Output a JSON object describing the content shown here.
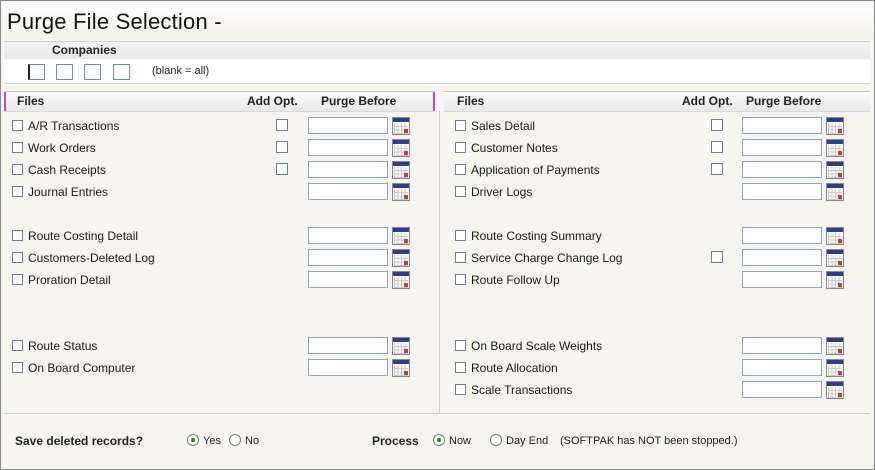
{
  "window": {
    "title": "Purge File Selection -"
  },
  "companies": {
    "heading": "Companies",
    "note": "(blank = all)"
  },
  "columns": {
    "files": "Files",
    "add_opt": "Add Opt.",
    "purge_before": "Purge Before"
  },
  "left_files": [
    {
      "label": "A/R Transactions",
      "add_opt": true
    },
    {
      "label": "Work Orders",
      "add_opt": true
    },
    {
      "label": "Cash Receipts",
      "add_opt": true
    },
    {
      "label": "Journal Entries",
      "add_opt": false
    },
    {
      "label": "Route Costing Detail",
      "add_opt": false
    },
    {
      "label": "Customers-Deleted Log",
      "add_opt": false
    },
    {
      "label": "Proration Detail",
      "add_opt": false
    },
    {
      "label": "Route Status",
      "add_opt": false
    },
    {
      "label": "On Board Computer",
      "add_opt": false
    }
  ],
  "right_files": [
    {
      "label": "Sales Detail",
      "add_opt": true
    },
    {
      "label": "Customer Notes",
      "add_opt": true
    },
    {
      "label": "Application of Payments",
      "add_opt": true
    },
    {
      "label": "Driver Logs",
      "add_opt": false
    },
    {
      "label": "Route Costing Summary",
      "add_opt": false
    },
    {
      "label": "Service Charge Change Log",
      "add_opt": true
    },
    {
      "label": "Route Follow Up",
      "add_opt": false
    },
    {
      "label": "On Board Scale Weights",
      "add_opt": false
    },
    {
      "label": "Route Allocation",
      "add_opt": false
    },
    {
      "label": "Scale Transactions",
      "add_opt": false
    }
  ],
  "save_deleted": {
    "question": "Save deleted records?",
    "yes": "Yes",
    "no": "No",
    "selected": "Yes"
  },
  "process": {
    "label": "Process",
    "now": "Now",
    "day_end": "Day End",
    "selected": "Now",
    "status": "(SOFTPAK has NOT been stopped.)"
  }
}
